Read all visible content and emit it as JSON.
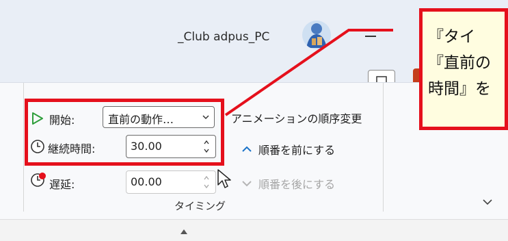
{
  "titlebar": {
    "account_name": "_Club adpus_PC"
  },
  "callout": {
    "line1": "『タイ",
    "line2": "『直前の",
    "line3": "時間』を"
  },
  "timing": {
    "start_label": "開始:",
    "start_value": "直前の動作…",
    "duration_label": "継続時間:",
    "duration_value": "30.00",
    "delay_label": "遅延:",
    "delay_value": "00.00",
    "group_label": "タイミング"
  },
  "reorder": {
    "title": "アニメーションの順序変更",
    "move_earlier": "順番を前にする",
    "move_later": "順番を後にする"
  },
  "colors": {
    "accent_red": "#e5101c",
    "play_green": "#2e9e3b",
    "ribbon_bg": "#f8f9fb"
  }
}
